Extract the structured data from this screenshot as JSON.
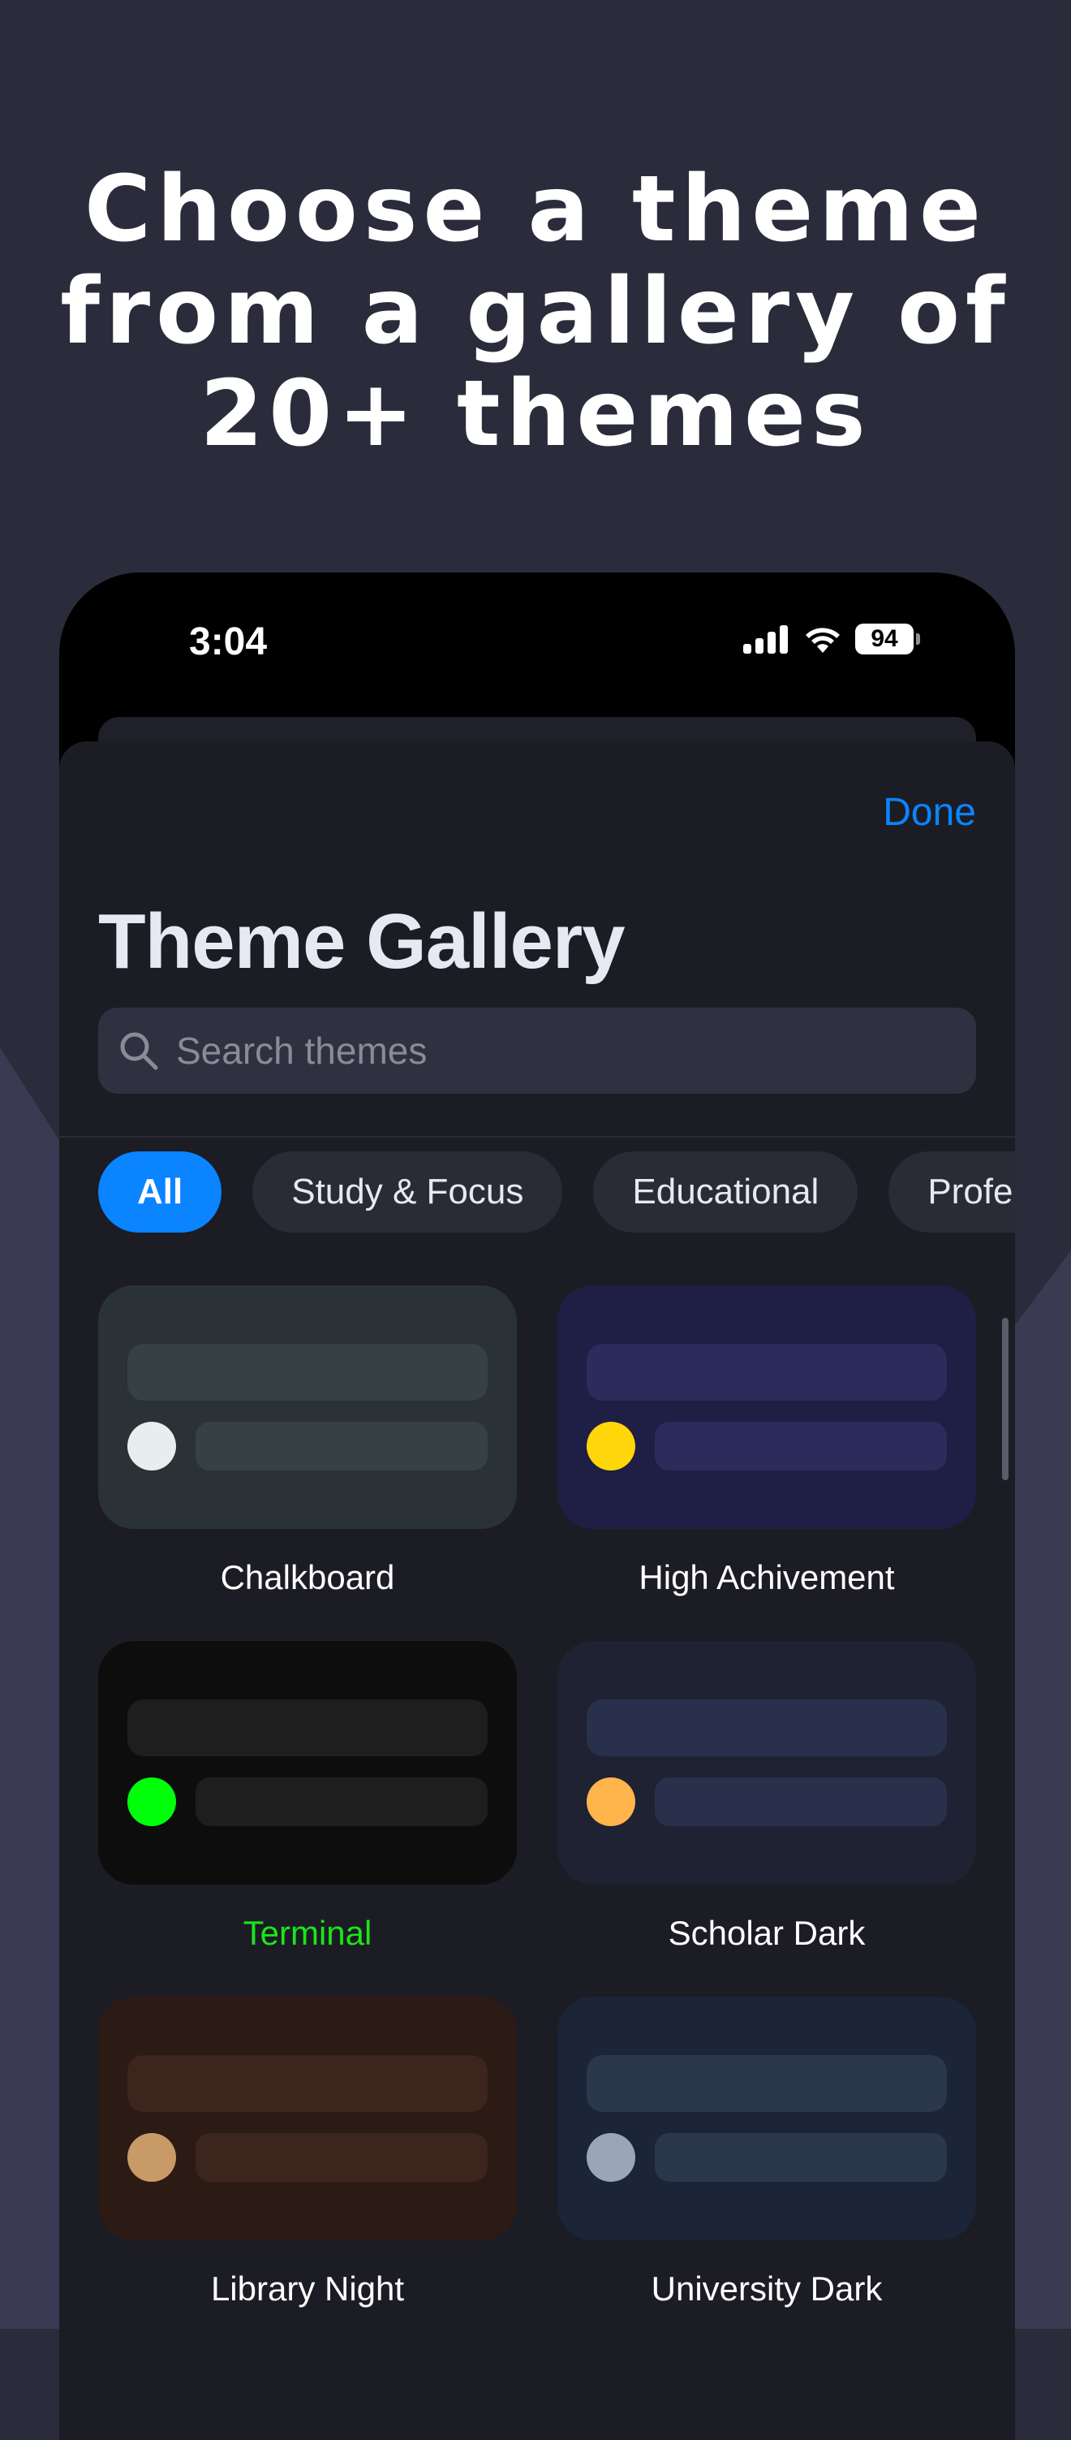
{
  "headline": [
    "Choose a theme",
    "from a gallery of",
    "20+ themes"
  ],
  "status_bar": {
    "time": "3:04",
    "battery": "94"
  },
  "sheet": {
    "done_label": "Done",
    "title": "Theme Gallery",
    "search_placeholder": "Search themes",
    "categories": [
      {
        "label": "All",
        "selected": true
      },
      {
        "label": "Study & Focus",
        "selected": false
      },
      {
        "label": "Educational",
        "selected": false
      },
      {
        "label": "Profe",
        "selected": false
      }
    ]
  },
  "themes": [
    {
      "name": "Chalkboard",
      "card_bg": "#2a3236",
      "bar": "#364145",
      "dot": "#e8eef0",
      "label_color": "#ffffff",
      "selected": false
    },
    {
      "name": "High Achivement",
      "card_bg": "#1f1f45",
      "bar": "#2b2b5c",
      "dot": "#ffd60a",
      "label_color": "#ffffff",
      "selected": false
    },
    {
      "name": "Terminal",
      "card_bg": "#0d0d0d",
      "bar": "#1e1e1e",
      "dot": "#00ff0a",
      "label_color": "#19e619",
      "selected": true
    },
    {
      "name": "Scholar Dark",
      "card_bg": "#1e2233",
      "bar": "#28304c",
      "dot": "#ffb54c",
      "label_color": "#ffffff",
      "selected": false
    },
    {
      "name": "Library Night",
      "card_bg": "#2c1a15",
      "bar": "#3b251d",
      "dot": "#c89a67",
      "label_color": "#ffffff",
      "selected": false
    },
    {
      "name": "University Dark",
      "card_bg": "#1c2538",
      "bar": "#2b374a",
      "dot": "#9aa5b8",
      "label_color": "#ffffff",
      "selected": false
    }
  ],
  "colors": {
    "accent": "#0a84ff",
    "background": "#2b2c3b",
    "sheet_background": "#1c1c24"
  }
}
